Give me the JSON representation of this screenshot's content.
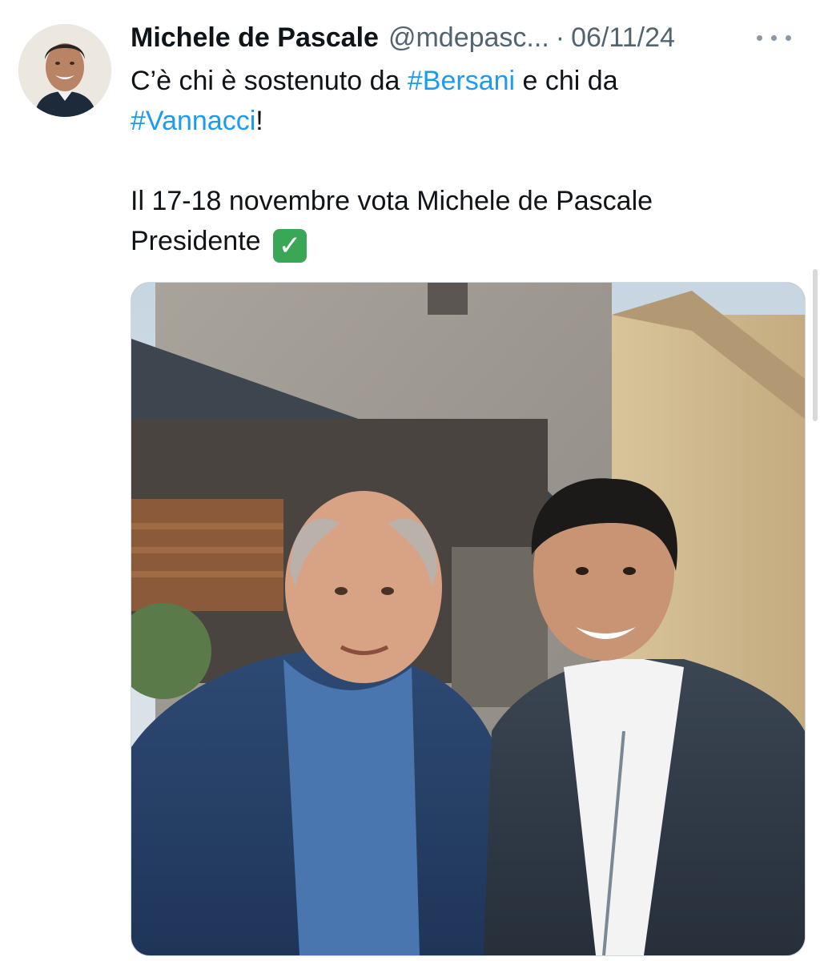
{
  "tweet": {
    "author_name": "Michele de Pascale",
    "handle": "@mdepasc...",
    "separator": "·",
    "date": "06/11/24",
    "line1_prefix": "C’è chi è sostenuto da ",
    "hashtag1": "#Bersani",
    "line1_suffix": " e chi da",
    "hashtag2": "#Vannacci",
    "line2_suffix": "!",
    "line3": "Il 17-18 novembre vota Michele de Pascale",
    "line4": "Presidente",
    "check_emoji": "✓"
  },
  "icons": {
    "more": "more-dots-icon",
    "avatar": "profile-avatar",
    "check": "check-mark-button-emoji"
  },
  "colors": {
    "link": "#1d9bf0",
    "secondary_text": "#536471",
    "primary_text": "#0f1419",
    "check_green": "#3aa757"
  }
}
